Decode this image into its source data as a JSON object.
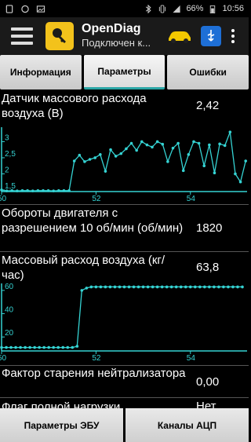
{
  "status_bar": {
    "battery": "66%",
    "time": "10:56",
    "icons": [
      "sim-card-icon",
      "whatsapp-icon",
      "image-icon",
      "bluetooth-icon",
      "vibrate-icon",
      "signal-icon",
      "battery-icon"
    ]
  },
  "app_bar": {
    "title": "OpenDiag",
    "subtitle": "Подключен к...",
    "icons": [
      "menu-icon",
      "app-logo-icon",
      "car-icon",
      "usb-icon",
      "more-icon"
    ]
  },
  "tabs": [
    {
      "label": "Информация",
      "active": false
    },
    {
      "label": "Параметры",
      "active": true
    },
    {
      "label": "Ошибки",
      "active": false
    }
  ],
  "params": [
    {
      "label": "Датчик массового расхода воздуха (В)",
      "value": "2,42"
    },
    {
      "label": "Обороты двигателя с разрешением 10 об/мин (об/мин)",
      "value": "1820"
    },
    {
      "label": "Массовый расход воздуха (кг/час)",
      "value": "63,8"
    },
    {
      "label": "Фактор старения нейтрализатора",
      "value": "0,00"
    },
    {
      "label": "Флаг полной нагрузки",
      "value": "Нет"
    }
  ],
  "chart_data": [
    {
      "type": "line",
      "color": "#35d3d3",
      "y_ticks": [
        "1,5",
        "2",
        "2,5",
        "3"
      ],
      "x_ticks": [
        "50",
        "52",
        "54"
      ],
      "xlim": [
        50,
        55.2
      ],
      "ylim": [
        1.45,
        3.45
      ],
      "x": [
        50.0,
        50.11,
        50.22,
        50.33,
        50.44,
        50.55,
        50.66,
        50.77,
        50.88,
        50.99,
        51.1,
        51.21,
        51.32,
        51.43,
        51.54,
        51.65,
        51.76,
        51.87,
        51.98,
        52.09,
        52.2,
        52.31,
        52.42,
        52.53,
        52.64,
        52.75,
        52.86,
        52.97,
        53.08,
        53.19,
        53.3,
        53.41,
        53.52,
        53.63,
        53.74,
        53.85,
        53.96,
        54.07,
        54.18,
        54.29,
        54.4,
        54.51,
        54.62,
        54.73,
        54.84,
        54.95,
        55.06,
        55.17
      ],
      "y": [
        1.5,
        1.47,
        1.48,
        1.47,
        1.48,
        1.48,
        1.47,
        1.48,
        1.48,
        1.48,
        1.47,
        1.48,
        1.48,
        1.48,
        2.4,
        2.58,
        2.38,
        2.45,
        2.5,
        2.6,
        2.08,
        2.75,
        2.55,
        2.63,
        2.78,
        2.95,
        2.73,
        3.0,
        2.9,
        2.83,
        3.0,
        2.92,
        2.38,
        2.8,
        2.95,
        2.1,
        2.6,
        3.0,
        2.95,
        2.25,
        2.9,
        2.03,
        2.93,
        2.88,
        3.3,
        2.0,
        1.75,
        2.4
      ]
    },
    {
      "type": "line",
      "color": "#35d3d3",
      "y_ticks": [
        "20",
        "40",
        "60"
      ],
      "x_ticks": [
        "50",
        "52",
        "54"
      ],
      "xlim": [
        50,
        55.2
      ],
      "ylim": [
        8,
        66
      ],
      "x": [
        50.0,
        50.1,
        50.2,
        50.3,
        50.4,
        50.5,
        50.6,
        50.7,
        50.8,
        50.9,
        51.0,
        51.1,
        51.2,
        51.3,
        51.4,
        51.5,
        51.6,
        51.7,
        51.8,
        51.9,
        52.0,
        52.1,
        52.2,
        52.3,
        52.4,
        52.5,
        52.6,
        52.7,
        52.8,
        52.9,
        53.0,
        53.1,
        53.2,
        53.3,
        53.4,
        53.5,
        53.6,
        53.7,
        53.8,
        53.9,
        54.0,
        54.1,
        54.2,
        54.3,
        54.4,
        54.5,
        54.6,
        54.7,
        54.8,
        54.9,
        55.0,
        55.1
      ],
      "y": [
        11,
        11,
        11,
        11,
        11,
        11,
        11,
        11,
        11,
        11,
        11,
        11,
        11,
        11,
        11,
        11,
        12,
        60,
        62,
        63,
        63,
        63,
        63,
        63,
        63,
        63,
        63,
        63,
        63,
        63,
        63,
        63,
        63,
        63,
        63,
        63,
        63,
        63,
        63,
        63,
        63,
        63,
        63,
        63,
        63,
        63,
        63,
        63,
        63,
        63,
        63,
        63
      ]
    }
  ],
  "bottom_bar": {
    "left_label": "Параметры ЭБУ",
    "right_label": "Каналы АЦП"
  }
}
